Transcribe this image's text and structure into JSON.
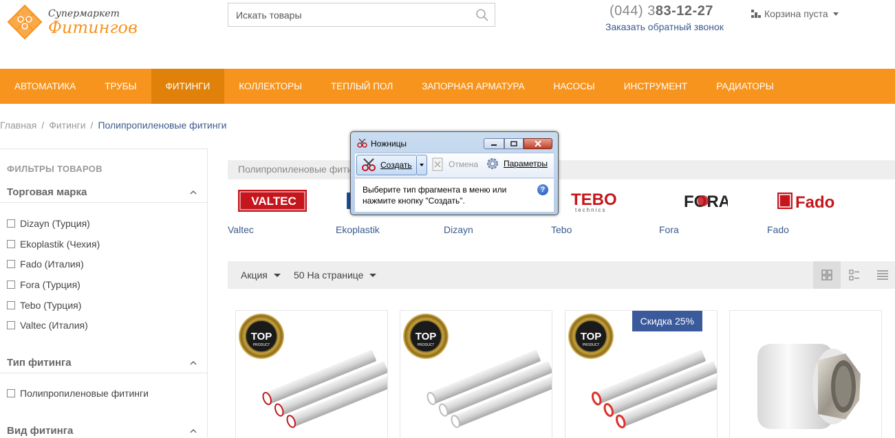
{
  "header": {
    "logo_line1": "Супермаркет",
    "logo_line2": "Фитингов",
    "search_placeholder": "Искать товары",
    "phone_prefix": "(044) 3",
    "phone_main": "83-12-27",
    "callback_label": "Заказать обратный звонок",
    "cart_label": "Корзина пуста"
  },
  "nav": {
    "items": [
      "АВТОМАТИКА",
      "ТРУБЫ",
      "ФИТИНГИ",
      "КОЛЛЕКТОРЫ",
      "ТЕПЛЫЙ ПОЛ",
      "ЗАПОРНАЯ АРМАТУРА",
      "НАСОСЫ",
      "ИНСТРУМЕНТ",
      "РАДИАТОРЫ"
    ],
    "active_index": 2
  },
  "breadcrumb": {
    "home": "Главная",
    "section": "Фитинги",
    "current": "Полипропиленовые фитинги",
    "separator": "/"
  },
  "sidebar": {
    "title": "ФИЛЬТРЫ ТОВАРОВ",
    "brand_group": "Торговая марка",
    "brands": [
      "Dizayn (Турция)",
      "Ekoplastik (Чехия)",
      "Fado (Италия)",
      "Fora (Турция)",
      "Tebo (Турция)",
      "Valtec (Италия)"
    ],
    "type_group": "Тип фитинга",
    "types": [
      "Полипропиленовые фитинги"
    ],
    "kind_group": "Вид фитинга"
  },
  "main": {
    "category_strip": "Полипропиленовые фити",
    "brand_logos": {
      "valtec": "VALTEC",
      "tebo": "TEBO",
      "tebo_sub": "technics",
      "fora": "FORA",
      "fado": "Fado"
    },
    "brands": [
      "Valtec",
      "Ekoplastik",
      "Dizayn",
      "Tebo",
      "Fora",
      "Fado"
    ],
    "toolbar": {
      "sort_label": "Акция",
      "per_page_label": "50 На странице"
    },
    "discount_badge": "Скидка 25%",
    "top_badge_text": "TOP",
    "top_badge_sub": "PRODUCT"
  },
  "snipping_tool": {
    "title": "Ножницы",
    "create_label": "Создать",
    "cancel_label": "Отмена",
    "params_label": "Параметры",
    "message": "Выберите тип фрагмента в меню или нажмите кнопку \"Создать\"."
  },
  "colors": {
    "accent": "#f7941d",
    "accent_active": "#e0820a",
    "link": "#3a5a8c",
    "badge": "#3a5a9c"
  }
}
